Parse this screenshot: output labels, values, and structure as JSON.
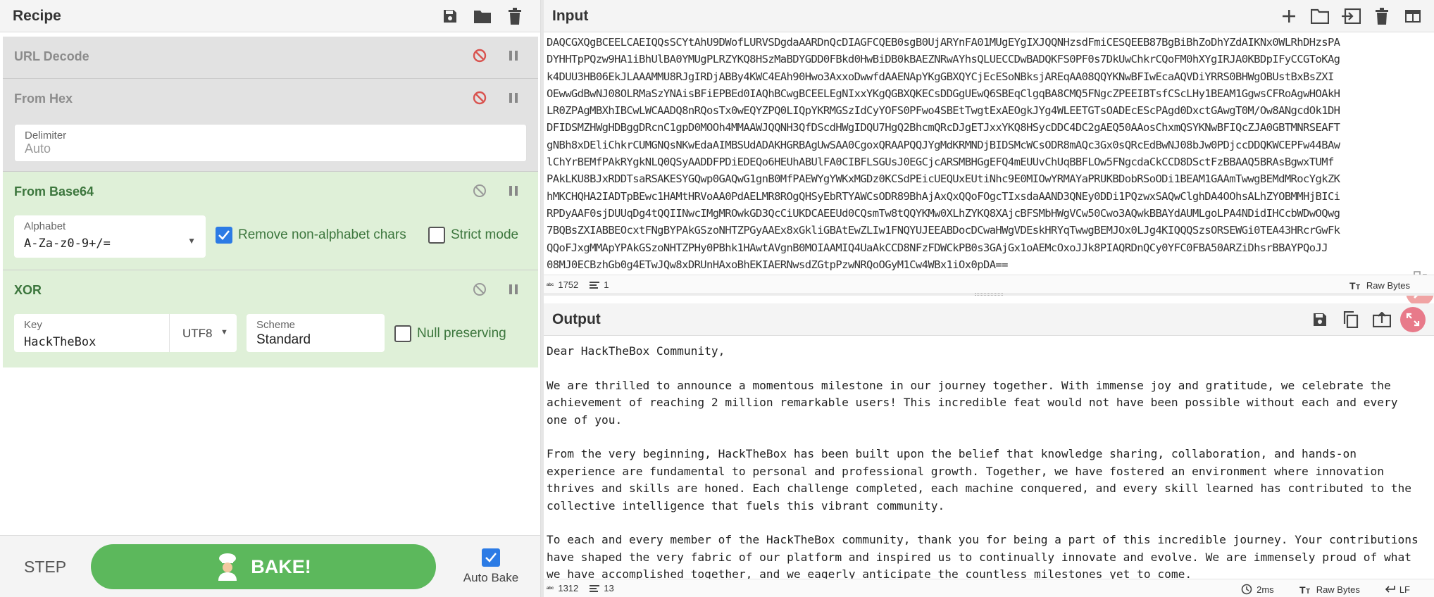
{
  "recipe": {
    "title": "Recipe",
    "operations": [
      {
        "name": "URL Decode",
        "state": "disabled"
      },
      {
        "name": "From Hex",
        "state": "disabled",
        "delimiter_label": "Delimiter",
        "delimiter_value": "Auto"
      },
      {
        "name": "From Base64",
        "state": "active",
        "alphabet_label": "Alphabet",
        "alphabet_value": "A-Za-z0-9+/=",
        "remove_label": "Remove non-alphabet chars",
        "remove_checked": true,
        "strict_label": "Strict mode",
        "strict_checked": false
      },
      {
        "name": "XOR",
        "state": "active",
        "key_label": "Key",
        "key_value": "HackTheBox",
        "encoding": "UTF8",
        "scheme_label": "Scheme",
        "scheme_value": "Standard",
        "null_label": "Null preserving",
        "null_checked": false
      }
    ],
    "step_label": "STEP",
    "bake_label": "BAKE!",
    "autobake_label": "Auto Bake",
    "autobake_checked": true
  },
  "input": {
    "title": "Input",
    "lines": [
      "DAQCGXQgBCEELCAEIQQsSCYtAhU9DWofLURVSDgdaAARDnQcDIAGFCQEB0sgB0UjARYnFA01MUgEYgIXJQQNHzsdFmiCESQEEB87BgBiBhZoDhYZdAIKNx0WLRhDHzsPA",
      "DYHHTpPQzw9HA1iBhUlBA0YMUgPLRZYKQ8HSzMaBDYGDD0FBkd0HwBiDB0kBAEZNRwAYhsQLUECCDwBADQKFS0PF0s7DkUwChkrCQoFM0hXYgIRJA0KBDpIFyCCGToKAg",
      "k4DUU3HB06EkJLAAAMMU8RJgIRDjABBy4KWC4EAh90Hwo3AxxoDwwfdAAENApYKgGBXQYCjEcESoNBksjAREqAA08QQYKNwBFIwEcaAQVDiYRRS0BHWgOBUstBxBsZXI",
      "OEwwGdBwNJ08OLRMaSzYNAisBFiEPBEd0IAQhBCwgBCEELEgNIxxYKgQGBXQKECsDDGgUEwQ6SBEqClgqBA8CMQ5FNgcZPEEIBTsfCScLHy1BEAM1GgwsCFRoAgwHOAkH",
      "LR0ZPAgMBXhIBCwLWCAADQ8nRQosTx0wEQYZPQ0LIQpYKRMGSzIdCyYOFS0PFwo4SBEtTwgtExAEOgkJYg4WLEETGTsOADEcEScPAgd0DxctGAwgT0M/Ow8ANgcdOk1DH",
      "DFIDSMZHWgHDBggDRcnC1gpD0MOOh4MMAAWJQQNH3QfDScdHWgIDQU7HgQ2BhcmQRcDJgETJxxYKQ8HSycDDC4DC2gAEQ50AAosChxmQSYKNwBFIQcZJA0GBTMNRSEAFT",
      "gNBh8xDEliChkrCUMGNQsNKwEdaAIMBSUdADAKHGRBAgUwSAA0CgoxQRAAPQQJYgMdKRMNDjBIDSMcWCsODR8mAQc3Gx0sQRcEdBwNJ08bJw0PDjccDDQKWCEPFw44BAw",
      "lChYrBEMfPAkRYgkNLQ0QSyAADDFPDiEDEQo6HEUhABUlFA0CIBFLSGUsJ0EGCjcARSMBHGgEFQ4mEUUvChUqBBFLOw5FNgcdaCkCCD8DSctFzBBAAQ5BRAsBgwxTUMf",
      "PAkLKU8BJxRDDTsaRSAKESYGQwp0GAQwG1gnB0MfPAEWYgYWKxMGDz0KCSdPEicUEQUxEUtiNhc9E0MIOwYRMAYaPRUKBDobRSoODi1BEAM1GAAmTwwgBEMdMRocYgkZK",
      "hMKCHQHA2IADTpBEwc1HAMtHRVoAA0PdAELMR8ROgQHSyEbRTYAWCsODR89BhAjAxQxQQoFOgcTIxsdaAAND3QNEy0DDi1PQzwxSAQwClghDA4OOhsALhZYOBMMHjBICi",
      "RPDyAAF0sjDUUqDg4tQQIINwcIMgMROwkGD3QcCiUKDCAEEUd0CQsmTw8tQQYKMw0XLhZYKQ8XAjcBFSMbHWgVCw50Cwo3AQwkBBAYdAUMLgoLPA4NDidIHCcbWDwOQwg",
      "7BQBsZXIABBEOcxtFNgBYPAkGSzoNHTZPGyAAEx8xGkliGBAtEwZLIw1FNQYUJEEABDocDCwaHWgVDEskHRYqTwwgBEMJOx0LJg4KIQQQSzsORSEWGi0TEA43HRcrGwFk",
      "QQoFJxgMMApYPAkGSzoNHTZPHy0PBhk1HAwtAVgnB0MOIAAMIQ4UaAkCCD8NFzFDWCkPB0s3GAjGx1oAEMcOxoJJk8PIAQRDnQCy0YFC0FBA50ARZiDhsrBBAYPQoJJ",
      "08MJ0ECBzhGb0g4ETwJQw8xDRUnHAxoBhEKIAERNwsdZGtpPzwNRQoOGyM1Cw4WBx1iOx0pDA=="
    ],
    "status": {
      "chars": "1752",
      "lines": "1",
      "encoding": "Raw Bytes"
    }
  },
  "output": {
    "title": "Output",
    "text": "Dear HackTheBox Community,\n\nWe are thrilled to announce a momentous milestone in our journey together. With immense joy and gratitude, we celebrate the achievement of reaching 2 million remarkable users! This incredible feat would not have been possible without each and every one of you.\n\nFrom the very beginning, HackTheBox has been built upon the belief that knowledge sharing, collaboration, and hands-on experience are fundamental to personal and professional growth. Together, we have fostered an environment where innovation thrives and skills are honed. Each challenge completed, each machine conquered, and every skill learned has contributed to the collective intelligence that fuels this vibrant community.\n\nTo each and every member of the HackTheBox community, thank you for being a part of this incredible journey. Your contributions have shaped the very fabric of our platform and inspired us to continually innovate and evolve. We are immensely proud of what we have accomplished together, and we eagerly anticipate the countless milestones yet to come.",
    "status": {
      "chars": "1312",
      "lines": "13",
      "time": "2ms",
      "encoding": "Raw Bytes",
      "eol": "LF"
    }
  },
  "colors": {
    "active_op": "#dff0d8",
    "disabled_op": "#e2e2e2",
    "bake": "#5cb85c",
    "check": "#2c7be5"
  }
}
